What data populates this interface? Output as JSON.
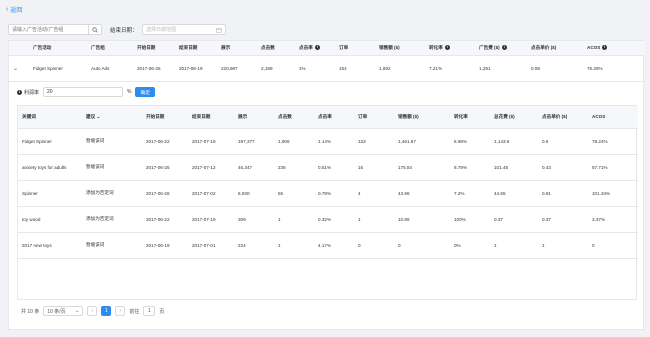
{
  "nav": {
    "back_label": "返回"
  },
  "search": {
    "placeholder": "请输入广告活动/广告组"
  },
  "date_filter": {
    "label": "结束日期：",
    "placeholder": "选择日期范围"
  },
  "campaign_table": {
    "headers": [
      "广告活动",
      "广告组",
      "开始日期",
      "结束日期",
      "展示",
      "点击数",
      "点击率",
      "订单",
      "销售额 ($)",
      "转化率",
      "广告费 ($)",
      "点击单价 ($)",
      "ACOS"
    ],
    "row": [
      "Fidget Spinner",
      "Auto Ads",
      "2017-06-25",
      "2017-08-19",
      "220,987",
      "2,199",
      "1%",
      "154",
      "1,692",
      "7.21%",
      "1,291",
      "0.59",
      "76.28%"
    ]
  },
  "filter": {
    "label": "利润率",
    "value": "20",
    "unit": "%",
    "confirm_label": "确定"
  },
  "keyword_table": {
    "headers": [
      "关键词",
      "建议",
      "开始日期",
      "结束日期",
      "展示",
      "点击数",
      "点击率",
      "订单",
      "销售额 ($)",
      "转化率",
      "总花费 ($)",
      "点击单价 ($)",
      "ACOS"
    ],
    "rows": [
      [
        "Fidget Spinner",
        "暂缓该词",
        "2017-06-22",
        "2017-07-19",
        "197,377",
        "1,906",
        "1.14%",
        "133",
        "1,461.67",
        "6.98%",
        "1,143.6",
        "0.6",
        "78.24%"
      ],
      [
        "anxiety toys for adults",
        "暂缓该词",
        "2017-06-25",
        "2017-07-12",
        "46,347",
        "236",
        "0.51%",
        "16",
        "175.84",
        "6.78%",
        "101.48",
        "0.43",
        "57.71%"
      ],
      [
        "Spinner",
        "添加为否定词",
        "2017-06-26",
        "2017-07-02",
        "6,930",
        "55",
        "0.79%",
        "4",
        "43.96",
        "7.2%",
        "44.55",
        "0.81",
        "101.34%"
      ],
      [
        "toy wood",
        "添加为否定词",
        "2017-06-22",
        "2017-07-19",
        "309",
        "1",
        "0.32%",
        "1",
        "10.89",
        "100%",
        "0.37",
        "0.37",
        "3.37%"
      ],
      [
        "2017 new toys",
        "暂缓该词",
        "2017-06-19",
        "2017-07-01",
        "224",
        "1",
        "4.17%",
        "0",
        "0",
        "0%",
        "1",
        "1",
        "0"
      ]
    ]
  },
  "pagination": {
    "total_label": "共 10 条",
    "page_size": "10 条/页",
    "current_page": "1",
    "goto_label": "前往",
    "goto_value": "1",
    "page_unit": "页"
  },
  "colors": {
    "accent": "#2d8cf0",
    "header_bg": "#f5f7fa",
    "border": "#e8e8e8"
  }
}
